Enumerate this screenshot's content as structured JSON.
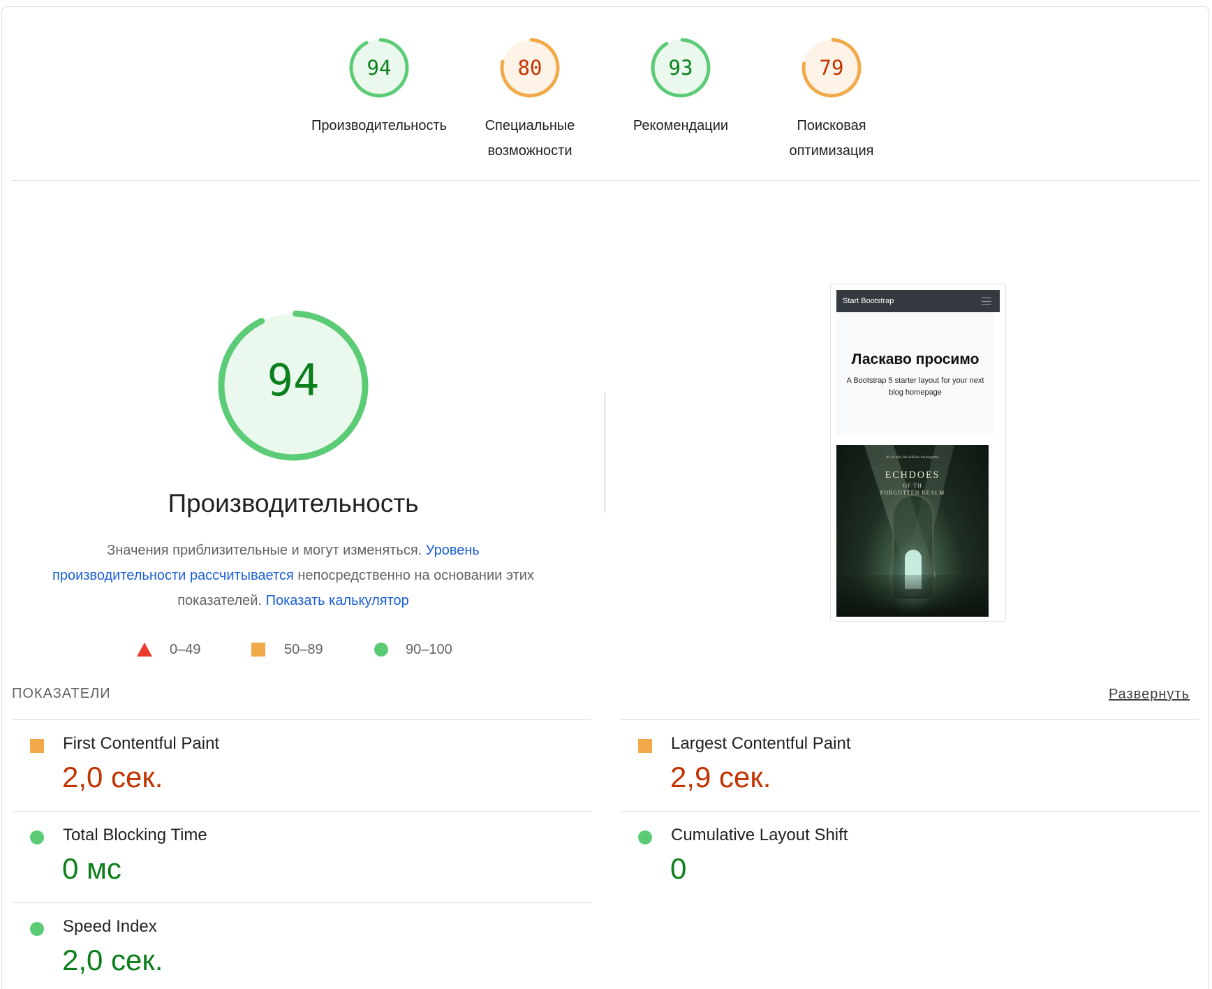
{
  "categories": [
    {
      "score": "94",
      "label_line1": "Производительность",
      "label_line2": "",
      "status": "pass",
      "fraction": 0.94
    },
    {
      "score": "80",
      "label_line1": "Специальные",
      "label_line2": "возможности",
      "status": "average",
      "fraction": 0.8
    },
    {
      "score": "93",
      "label_line1": "Рекомендации",
      "label_line2": "",
      "status": "pass",
      "fraction": 0.93
    },
    {
      "score": "79",
      "label_line1": "Поисковая",
      "label_line2": "оптимизация",
      "status": "average",
      "fraction": 0.79
    }
  ],
  "performance": {
    "score": "94",
    "fraction": 0.94,
    "title": "Производительность",
    "desc_text1": "Значения приблизительные и могут изменяться. ",
    "desc_link1": "Уровень производительности рассчитывается",
    "desc_text2": " непосредственно на основании этих показателей. ",
    "desc_link2": "Показать калькулятор"
  },
  "legend": {
    "fail": "0–49",
    "average": "50–89",
    "pass": "90–100"
  },
  "screenshot": {
    "navbar_brand": "Start Bootstrap",
    "hero_title": "Ласкаво просимо",
    "hero_text": "A Bootstrap 5 starter layout for your next blog homepage",
    "art_title": "ECHDOES",
    "art_subtitle1": "OF TH",
    "art_subtitle2": "FORGOTTEN REALM",
    "art_tagline": "It's all told, the wild lies not forgotten"
  },
  "metrics": {
    "header": "ПОКАЗАТЕЛИ",
    "expand_label": "Развернуть",
    "items": [
      {
        "name": "First Contentful Paint",
        "value": "2,0 сек.",
        "status": "average"
      },
      {
        "name": "Largest Contentful Paint",
        "value": "2,9 сек.",
        "status": "average"
      },
      {
        "name": "Total Blocking Time",
        "value": "0 мс",
        "status": "pass"
      },
      {
        "name": "Cumulative Layout Shift",
        "value": "0",
        "status": "pass"
      },
      {
        "name": "Speed Index",
        "value": "2,0 сек.",
        "status": "pass"
      }
    ]
  },
  "colors": {
    "pass": "#0b7f1b",
    "pass_ring": "#5ccb75",
    "pass_bg": "#eaf8ee",
    "average": "#c33300",
    "average_ring": "#f2a94a",
    "average_bg": "#fdf3e6",
    "fail": "#eb3b2f",
    "link": "#1a5fd6"
  }
}
